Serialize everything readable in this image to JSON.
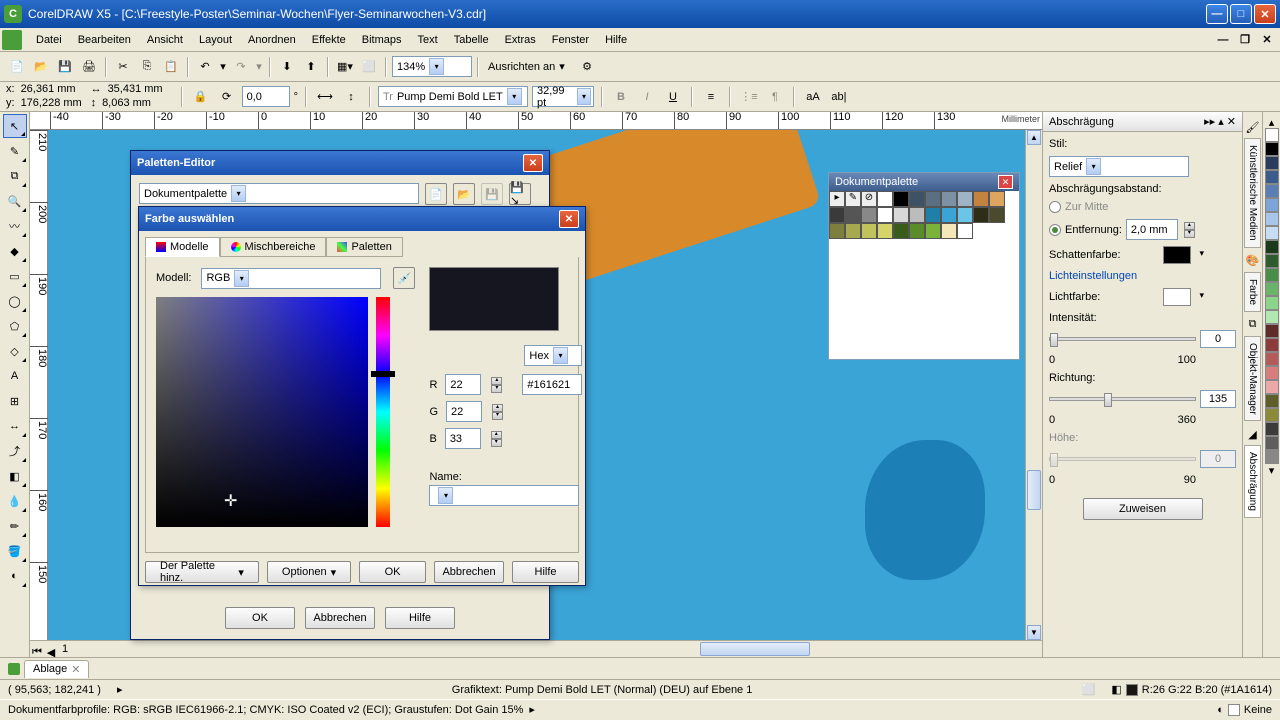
{
  "app": {
    "title": "CorelDRAW X5 - [C:\\Freestyle-Poster\\Seminar-Wochen\\Flyer-Seminarwochen-V3.cdr]"
  },
  "menu": [
    "Datei",
    "Bearbeiten",
    "Ansicht",
    "Layout",
    "Anordnen",
    "Effekte",
    "Bitmaps",
    "Text",
    "Tabelle",
    "Extras",
    "Fenster",
    "Hilfe"
  ],
  "toolbar": {
    "zoom": "134%",
    "align": "Ausrichten an"
  },
  "propbar": {
    "x": "26,361 mm",
    "y": "176,228 mm",
    "w": "35,431 mm",
    "h": "8,063 mm",
    "rot": "0,0",
    "font": "Pump Demi Bold LET",
    "size": "32,99 pt"
  },
  "ruler_h": [
    -40,
    -30,
    -20,
    -10,
    0,
    10,
    20,
    30,
    40,
    50,
    60,
    70,
    80,
    90,
    100,
    110,
    120,
    130
  ],
  "ruler_v": [
    210,
    200,
    190,
    180,
    170,
    160,
    150
  ],
  "ruler_unit": "Millimeter",
  "docker": {
    "title": "Abschrägung",
    "stil_label": "Stil:",
    "stil_value": "Relief",
    "abstand_label": "Abschrägungsabstand:",
    "zurmitte": "Zur Mitte",
    "entfernung": "Entfernung:",
    "entfernung_val": "2,0 mm",
    "schatten": "Schattenfarbe:",
    "licht_link": "Lichteinstellungen",
    "lichtfarbe": "Lichtfarbe:",
    "intens": "Intensität:",
    "intens_val": "0",
    "intens_min": "0",
    "intens_max": "100",
    "richt": "Richtung:",
    "richt_val": "135",
    "richt_min": "0",
    "richt_max": "360",
    "hoehe": "Höhe:",
    "hoehe_val": "0",
    "hoehe_min": "0",
    "hoehe_max": "90",
    "zuweisen": "Zuweisen"
  },
  "vtabs": [
    "Künstlerische Medien",
    "Farbe",
    "Objekt-Manager",
    "Abschrägung"
  ],
  "palette_editor": {
    "title": "Paletten-Editor",
    "dropdown": "Dokumentpalette",
    "ok": "OK",
    "cancel": "Abbrechen",
    "help": "Hilfe"
  },
  "color_dialog": {
    "title": "Farbe auswählen",
    "tabs": {
      "modelle": "Modelle",
      "misch": "Mischbereiche",
      "pal": "Paletten"
    },
    "model_label": "Modell:",
    "model_value": "RGB",
    "hex_label": "Hex",
    "hex_val": "#161621",
    "r_label": "R",
    "r_val": "22",
    "g_label": "G",
    "g_val": "22",
    "b_label": "B",
    "b_val": "33",
    "name_label": "Name:",
    "name_val": "",
    "add": "Der Palette hinz.",
    "options": "Optionen",
    "ok": "OK",
    "cancel": "Abbrechen",
    "help": "Hilfe"
  },
  "doc_palette": {
    "title": "Dokumentpalette"
  },
  "palette_colors": [
    "#fff",
    "#000",
    "#3e5266",
    "#5b6f83",
    "#7d91a5",
    "#9fb3c7",
    "#c1833d",
    "#dda55f",
    "#3a3a3a",
    "#555",
    "#888",
    "#fff",
    "#d8d8d8",
    "#bcbcbc",
    "#1f7fa9",
    "#3ba4d6",
    "#6bc5e8",
    "#2e2e18",
    "#4a4a2c",
    "#7e7e3e",
    "#a8a84e",
    "#c2c25c",
    "#d4d46a",
    "#3a5c1a",
    "#5a8c2a",
    "#7bb33a",
    "#f4e7b8",
    "#fff"
  ],
  "tabs_bottom": {
    "label": "Ablage"
  },
  "status1": {
    "coords": "( 95,563; 182,241 )",
    "info": "Grafiktext: Pump Demi Bold LET (Normal) (DEU) auf Ebene 1",
    "rgb": "R:26 G:22 B:20 (#1A1614)",
    "none": "Keine"
  },
  "status2": "Dokumentfarbprofile: RGB: sRGB IEC61966-2.1; CMYK: ISO Coated v2 (ECI); Graustufen: Dot Gain 15%",
  "colorbar": [
    "#fff",
    "#000",
    "#2a3b5e",
    "#3b5c8b",
    "#5b7fb3",
    "#7da4d8",
    "#a8c6ea",
    "#c7ddf3",
    "#1a3a1a",
    "#2e5c2e",
    "#4a8c4a",
    "#6bb36b",
    "#8cd48c",
    "#b3e8b3",
    "#5e2a2a",
    "#8b3b3b",
    "#b35b5b",
    "#d87d7d",
    "#eaa8a8",
    "#5e5e2a",
    "#8b8b3b",
    "#3b3b3b",
    "#5e5e5e",
    "#888"
  ]
}
